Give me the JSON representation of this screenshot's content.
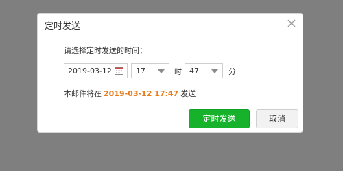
{
  "dialog": {
    "title": "定时发送",
    "prompt": "请选择定时发送的时间：",
    "date_value": "2019-03-12",
    "hour_value": "17",
    "hour_unit": "时",
    "minute_value": "47",
    "minute_unit": "分",
    "summary_prefix": "本邮件将在",
    "summary_time": "2019-03-12 17:47",
    "summary_suffix": "发送",
    "confirm_label": "定时发送",
    "cancel_label": "取消"
  },
  "icons": {
    "close": "close-icon",
    "calendar": "calendar-icon",
    "dropdown": "chevron-down-icon"
  },
  "colors": {
    "overlay": "#7f7f7f",
    "highlight": "#e87d1e",
    "primary": "#16b22c"
  }
}
